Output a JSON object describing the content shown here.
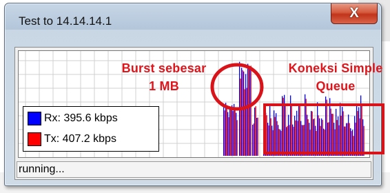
{
  "window": {
    "title": "Test to 14.14.14.1",
    "close_label": "X"
  },
  "legend": {
    "rx": {
      "label": "Rx: 395.6 kbps",
      "color": "#0000ff"
    },
    "tx": {
      "label": "Tx: 407.2 kbps",
      "color": "#ff0000"
    }
  },
  "annotations": {
    "burst": [
      "Burst sebesar",
      "1 MB"
    ],
    "queue": [
      "Koneksi Simple",
      "Queue"
    ],
    "color": "#e0141b"
  },
  "status": {
    "text": "running..."
  }
}
